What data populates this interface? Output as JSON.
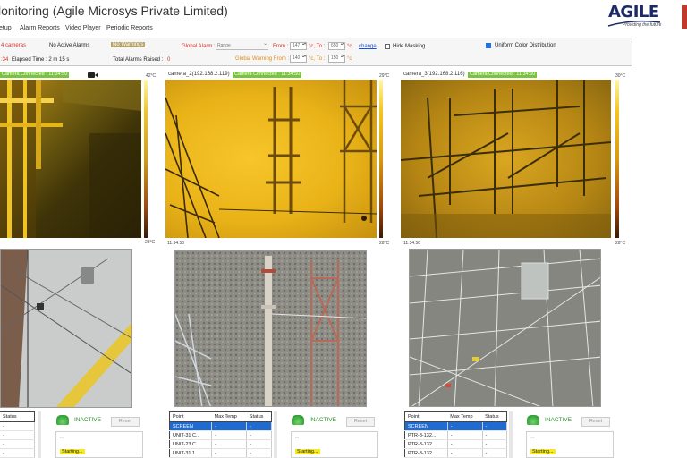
{
  "app": {
    "title": "lonitoring (Agile Microsys Private Limited)"
  },
  "logo": {
    "word": "AGILE",
    "tagline": "Providing the future"
  },
  "menu": [
    "etup",
    "Alarm Reports",
    "Video Player",
    "Periodic Reports"
  ],
  "status": {
    "cameras": "4 cameras",
    "active_alarms": "No Active Alarms",
    "warnings": "No Warnings",
    "time_prefix": ":34",
    "elapsed": "Elapsed Time : 2 m 15 s",
    "alarms_raised_label": "Total Alarms Raised :",
    "alarms_raised_value": "0"
  },
  "alarm_controls": {
    "global_alarm_label": "Global Alarm :",
    "global_alarm_value": "Range",
    "from_label": "From :",
    "from_value": "147",
    "unit_to": "°c, To :",
    "to_value": "650",
    "unit": "°c",
    "change_link": "change",
    "hide_masking": "Hide Masking",
    "uniform_color": "Uniform Color Distribution",
    "global_warning_label": "Global Warning From :",
    "warn_from_value": "140",
    "warn_to_value": "150"
  },
  "cameras": [
    {
      "header": "",
      "connected": "Camera Connected : 11:34:50",
      "temp_max": "42°C",
      "temp_min": "28°C",
      "timestamp": "",
      "has_cam_icon": true
    },
    {
      "header": "camera_2(192.168.2.119)",
      "connected": "Camera Connected : 11:34:50",
      "temp_max": "29°C",
      "temp_min": "28°C",
      "timestamp": "11:34:50"
    },
    {
      "header": "camera_3(192.168.2.116)",
      "connected": "Camera Connected : 11:34:50",
      "temp_max": "30°C",
      "temp_min": "28°C",
      "timestamp": "11:34:50"
    }
  ],
  "tables": [
    {
      "headers": [
        "Status"
      ],
      "rows": [
        [
          "-"
        ],
        [
          "-"
        ],
        [
          "-"
        ],
        [
          "-"
        ]
      ]
    },
    {
      "headers": [
        "Point",
        "Max Temp",
        "Status"
      ],
      "rows": [
        [
          "SCREEN",
          "-",
          "-"
        ],
        [
          "UNIT-31 C...",
          "-",
          "-"
        ],
        [
          "UNIT-23 C...",
          "-",
          "-"
        ],
        [
          "UNIT-31 1...",
          "-",
          "-"
        ]
      ]
    },
    {
      "headers": [
        "Point",
        "Max Temp",
        "Status"
      ],
      "rows": [
        [
          "SCREEN",
          "-",
          "-"
        ],
        [
          "PTR-3-132...",
          "-",
          "-"
        ],
        [
          "PTR-3-132...",
          "-",
          "-"
        ],
        [
          "PTR-3-132...",
          "-",
          "-"
        ]
      ]
    }
  ],
  "alarm_state": {
    "label": "INACTIVE",
    "reset": "Reset",
    "log_line": "...",
    "starting": "Starting..."
  }
}
